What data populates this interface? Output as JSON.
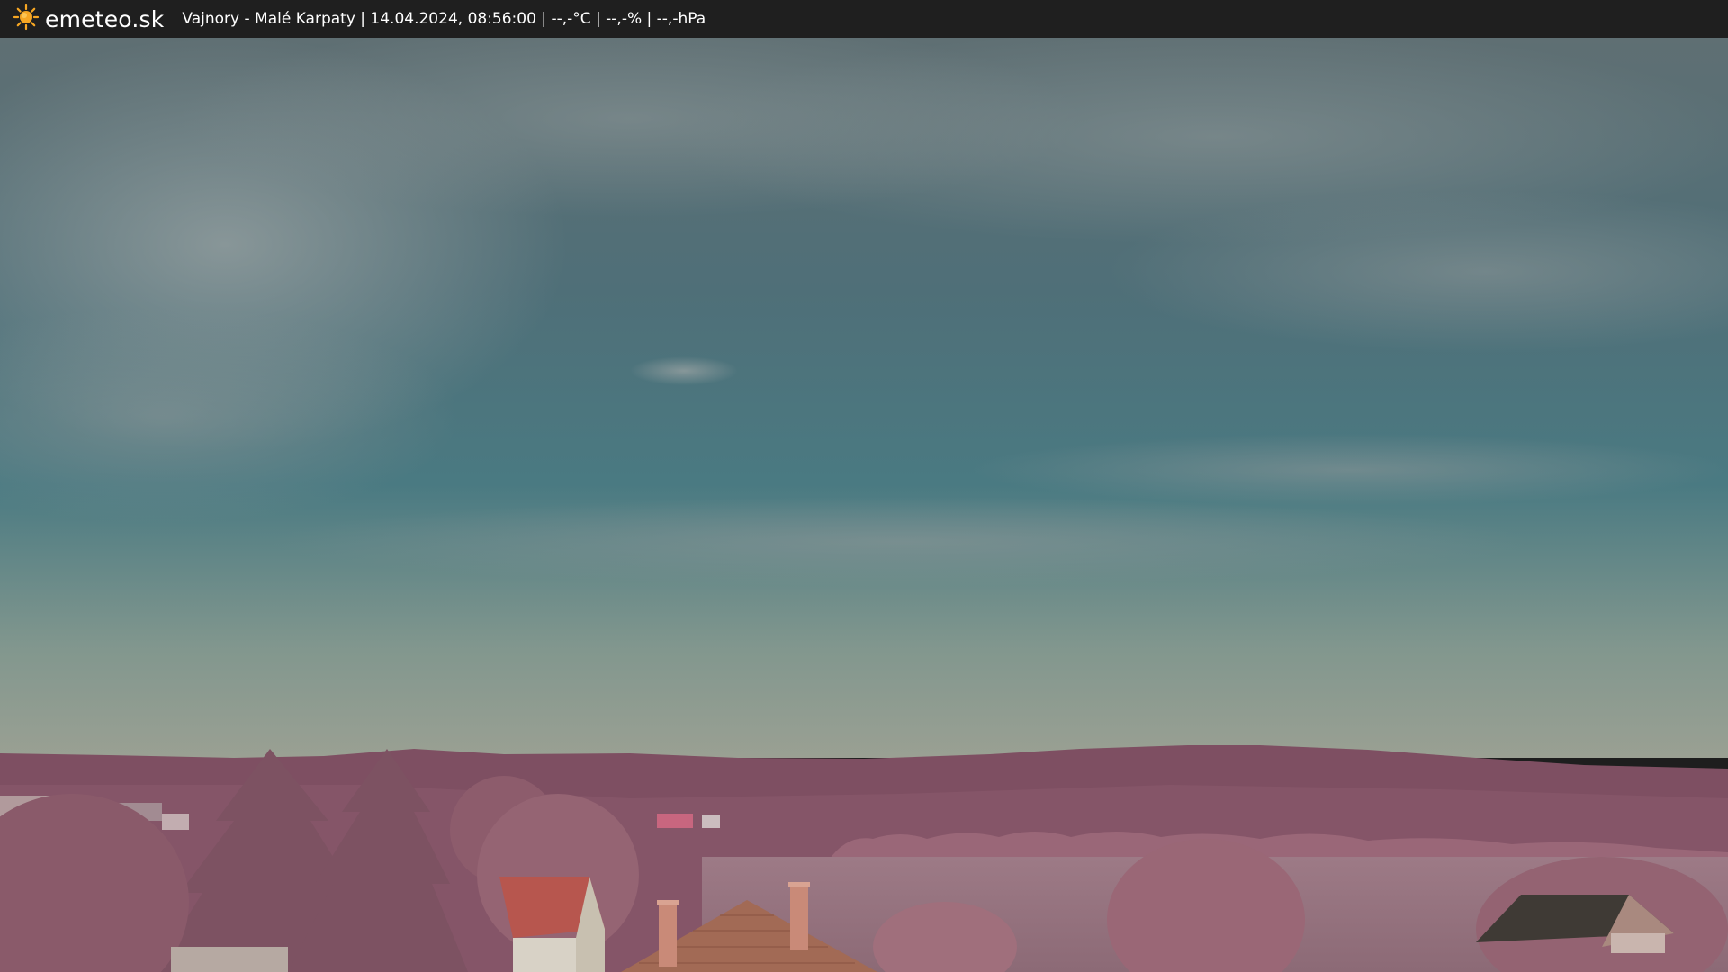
{
  "header": {
    "logo_text": "emeteo.sk",
    "status": "Vajnory - Malé Karpaty | 14.04.2024, 08:56:00 | --,-°C | --,-% | --,-hPa",
    "logo_icon": "sun-icon",
    "bar_color": "#1f1f1f",
    "sun_color": "#f6a623"
  },
  "scene": {
    "description_icon": "webcam-image",
    "sky_colors": [
      "#5c7278",
      "#4a7580",
      "#8a9a8f"
    ],
    "vegetation_color": "#9c6a76",
    "roof_color": "#b86a5a"
  }
}
